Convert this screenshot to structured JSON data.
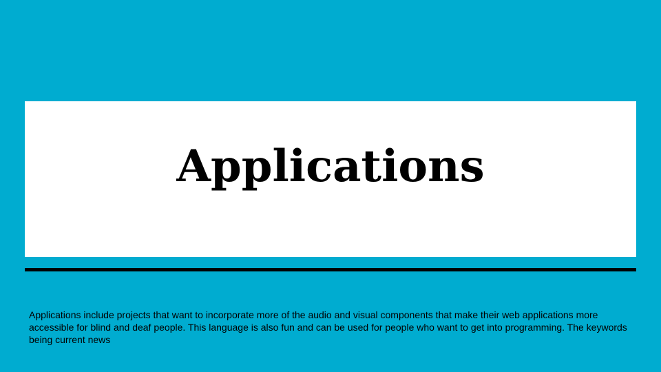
{
  "slide": {
    "title": "Applications",
    "body": "Applications include projects that want to incorporate more of the audio and visual components that make their web applications more accessible for blind and deaf people. This language is also fun and can be used for people who want to get into programming. The keywords being current news"
  },
  "colors": {
    "background": "#00acd0",
    "title_box": "#ffffff",
    "divider": "#000000",
    "text": "#000000"
  }
}
